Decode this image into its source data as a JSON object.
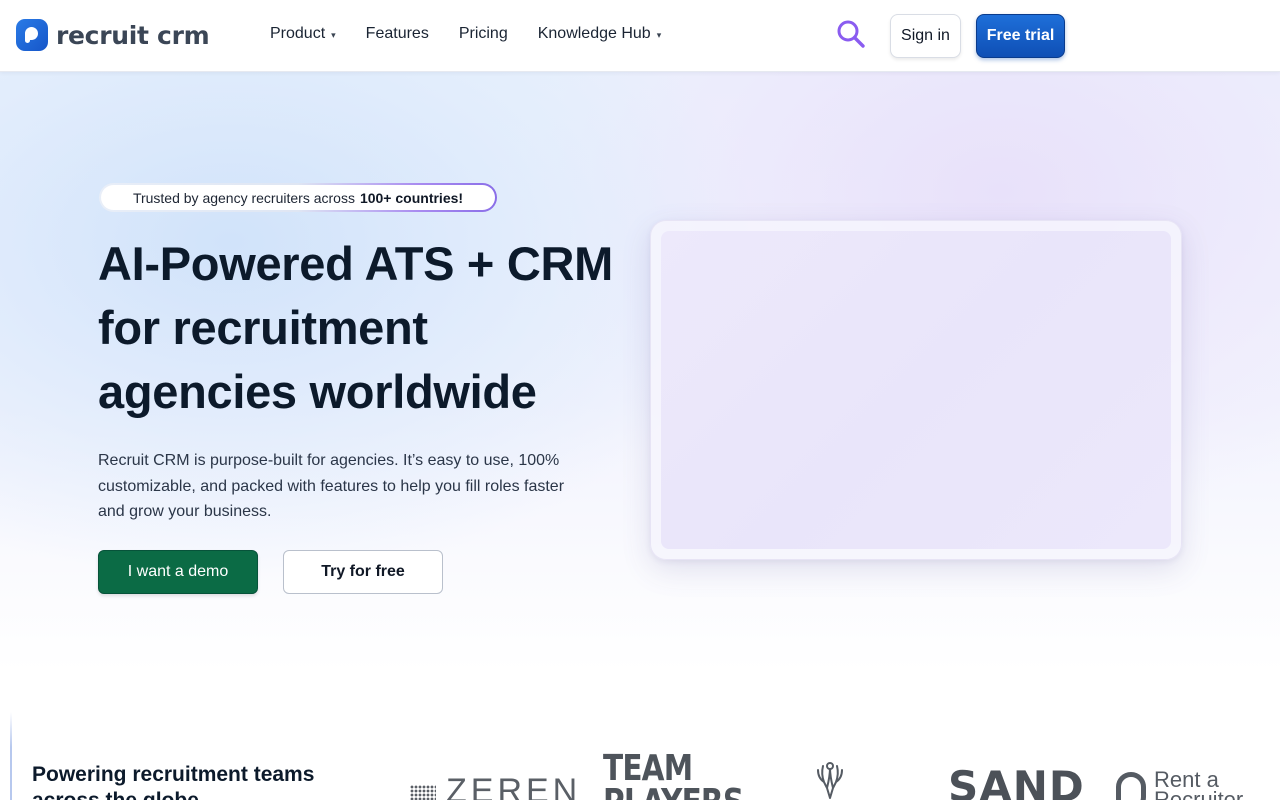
{
  "header": {
    "logo_text": "recruit crm",
    "nav": [
      {
        "label": "Product",
        "has_caret": true
      },
      {
        "label": "Features",
        "has_caret": false
      },
      {
        "label": "Pricing",
        "has_caret": false
      },
      {
        "label": "Knowledge Hub",
        "has_caret": true
      }
    ],
    "caret_glyph": "▾",
    "signin_label": "Sign in",
    "free_trial_label": "Free trial",
    "search_icon": "search-icon",
    "accent_color": "#1e6fd9",
    "search_icon_color": "#8a5cf0"
  },
  "hero": {
    "badge_prefix": "Trusted by agency recruiters across",
    "badge_bold": "100+ countries!",
    "title": "AI-Powered ATS + CRM for recruitment agencies worldwide",
    "lead": "Recruit CRM is purpose-built for agencies. It’s easy to use, 100% customizable, and packed with features to help you fill roles faster and grow your business.",
    "demo_label": "I want a demo",
    "try_label": "Try for free",
    "demo_color": "#0b6b45"
  },
  "clients": {
    "title": "Powering recruitment teams across the globe",
    "logos": [
      {
        "name": "ZEREN"
      },
      {
        "name": "TEAM PLAYERS",
        "line1": "TEAM",
        "line2": "PLAYERS"
      },
      {
        "name": "antler-logo"
      },
      {
        "name": "SAND"
      },
      {
        "name": "Rent a Recruiter",
        "line1": "Rent a",
        "line2": "Recruiter"
      }
    ]
  }
}
